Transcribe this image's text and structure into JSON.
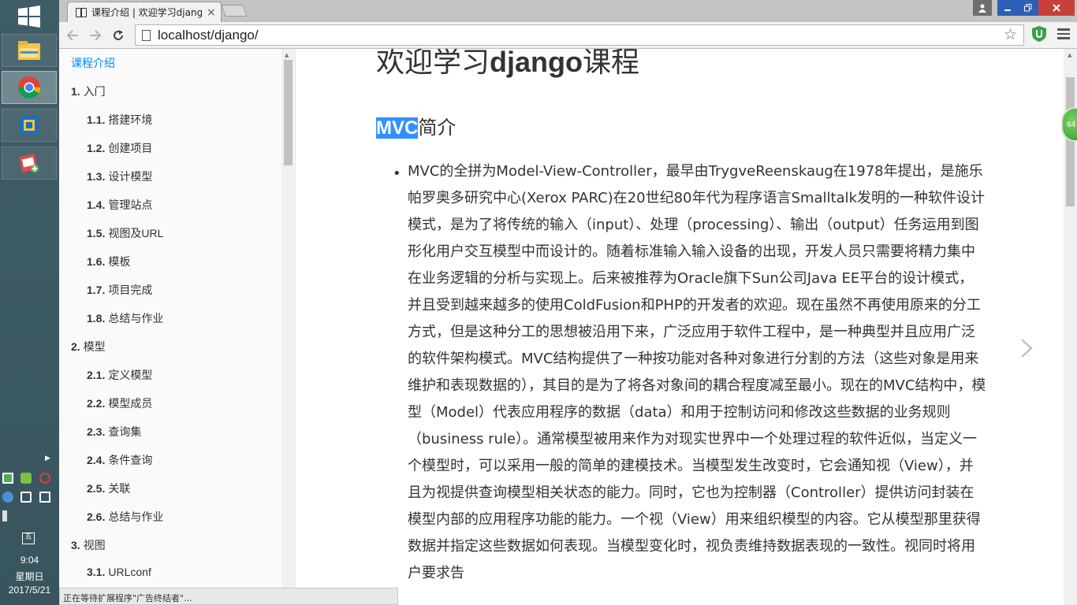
{
  "taskbar": {
    "clock_time": "9:04",
    "clock_weekday": "星期日",
    "clock_date": "2017/5/21",
    "calendar_glyph": "五"
  },
  "browser": {
    "tab_title": "课程介绍 | 欢迎学习django课程",
    "tab_close": "×",
    "url": "localhost/django/"
  },
  "sidebar": {
    "items": [
      {
        "num": "",
        "label": "课程介绍"
      },
      {
        "num": "1.",
        "label": "入门"
      },
      {
        "num": "1.1.",
        "label": "搭建环境"
      },
      {
        "num": "1.2.",
        "label": "创建项目"
      },
      {
        "num": "1.3.",
        "label": "设计模型"
      },
      {
        "num": "1.4.",
        "label": "管理站点"
      },
      {
        "num": "1.5.",
        "label": "视图及URL"
      },
      {
        "num": "1.6.",
        "label": "模板"
      },
      {
        "num": "1.7.",
        "label": "项目完成"
      },
      {
        "num": "1.8.",
        "label": "总结与作业"
      },
      {
        "num": "2.",
        "label": "模型"
      },
      {
        "num": "2.1.",
        "label": "定义模型"
      },
      {
        "num": "2.2.",
        "label": "模型成员"
      },
      {
        "num": "2.3.",
        "label": "查询集"
      },
      {
        "num": "2.4.",
        "label": "条件查询"
      },
      {
        "num": "2.5.",
        "label": "关联"
      },
      {
        "num": "2.6.",
        "label": "总结与作业"
      },
      {
        "num": "3.",
        "label": "视图"
      },
      {
        "num": "3.1.",
        "label": "URLconf"
      }
    ]
  },
  "status_text": "正在等待扩展程序\"广告终结者\"...",
  "main": {
    "h1_pre": "欢迎学习",
    "h1_bold": "django",
    "h1_post": "课程",
    "h2_selected": "MVC",
    "h2_rest": "简介",
    "paragraph": "MVC的全拼为Model-View-Controller，最早由TrygveReenskaug在1978年提出，是施乐帕罗奥多研究中心(Xerox PARC)在20世纪80年代为程序语言Smalltalk发明的一种软件设计模式，是为了将传统的输入（input）、处理（processing）、输出（output）任务运用到图形化用户交互模型中而设计的。随着标准输入输入设备的出现，开发人员只需要将精力集中在业务逻辑的分析与实现上。后来被推荐为Oracle旗下Sun公司Java EE平台的设计模式，并且受到越来越多的使用ColdFusion和PHP的开发者的欢迎。现在虽然不再使用原来的分工方式，但是这种分工的思想被沿用下来，广泛应用于软件工程中，是一种典型并且应用广泛的软件架构模式。MVC结构提供了一种按功能对各种对象进行分割的方法（这些对象是用来维护和表现数据的），其目的是为了将各对象间的耦合程度减至最小。现在的MVC结构中，模型（Model）代表应用程序的数据（data）和用于控制访问和修改这些数据的业务规则（business rule）。通常模型被用来作为对现实世界中一个处理过程的软件近似，当定义一个模型时，可以采用一般的简单的建模技术。当模型发生改变时，它会通知视（View），并且为视提供查询模型相关状态的能力。同时，它也为控制器（Controller）提供访问封装在模型内部的应用程序功能的能力。一个视（View）用来组织模型的内容。它从模型那里获得数据并指定这些数据如何表现。当模型变化时，视负责维持数据表现的一致性。视同时将用户要求告"
  },
  "badge": "64",
  "colors": {
    "toc_current": "#008cff",
    "selection": "#3390ff",
    "taskbar_bg": "#3f5d67"
  },
  "icons": [
    "windows-start-icon",
    "file-explorer-icon",
    "chrome-icon",
    "virtualbox-icon",
    "notepad-icon",
    "back-icon",
    "forward-icon",
    "reload-icon",
    "page-icon",
    "star-icon",
    "adblock-shield-icon",
    "chrome-menu-icon",
    "next-page-icon"
  ]
}
